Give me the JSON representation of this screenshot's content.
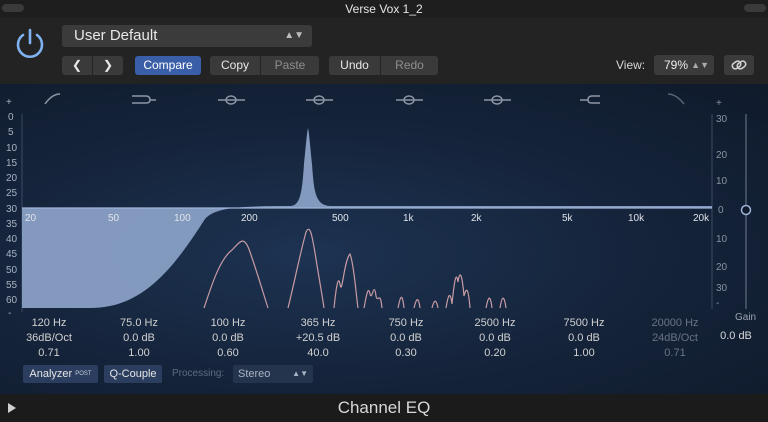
{
  "window": {
    "title": "Verse Vox 1_2"
  },
  "header": {
    "preset": "User Default",
    "compare": "Compare",
    "copy": "Copy",
    "paste": "Paste",
    "undo": "Undo",
    "redo": "Redo",
    "view_label": "View:",
    "view_value": "79%"
  },
  "graph": {
    "db_scale_left": [
      "+",
      "0",
      "5",
      "10",
      "15",
      "20",
      "25",
      "30",
      "35",
      "40",
      "45",
      "50",
      "55",
      "60",
      "-"
    ],
    "db_scale_right": [
      "+",
      "30",
      "20",
      "10",
      "0",
      "10",
      "20",
      "30",
      "-"
    ],
    "freq_labels": [
      "20",
      "50",
      "100",
      "200",
      "500",
      "1k",
      "2k",
      "5k",
      "10k",
      "20k"
    ]
  },
  "bands": [
    {
      "freq": "120 Hz",
      "gain": "36dB/Oct",
      "q": "0.71",
      "active": true
    },
    {
      "freq": "75.0 Hz",
      "gain": "0.0 dB",
      "q": "1.00",
      "active": true
    },
    {
      "freq": "100 Hz",
      "gain": "0.0 dB",
      "q": "0.60",
      "active": true
    },
    {
      "freq": "365 Hz",
      "gain": "+20.5 dB",
      "q": "40.0",
      "active": true
    },
    {
      "freq": "750 Hz",
      "gain": "0.0 dB",
      "q": "0.30",
      "active": true
    },
    {
      "freq": "2500 Hz",
      "gain": "0.0 dB",
      "q": "0.20",
      "active": true
    },
    {
      "freq": "7500 Hz",
      "gain": "0.0 dB",
      "q": "1.00",
      "active": true
    },
    {
      "freq": "20000 Hz",
      "gain": "24dB/Oct",
      "q": "0.71",
      "active": false
    }
  ],
  "gain": {
    "label": "Gain",
    "value": "0.0 dB"
  },
  "controls": {
    "analyzer": "Analyzer",
    "analyzer_badge": "POST",
    "qcouple": "Q-Couple",
    "processing_label": "Processing:",
    "processing_value": "Stereo"
  },
  "footer": {
    "plugin_name": "Channel EQ"
  },
  "colors": {
    "accent": "#3a5fa8",
    "fill": "#8fa6cc",
    "spectrum": "#c89ba4"
  }
}
